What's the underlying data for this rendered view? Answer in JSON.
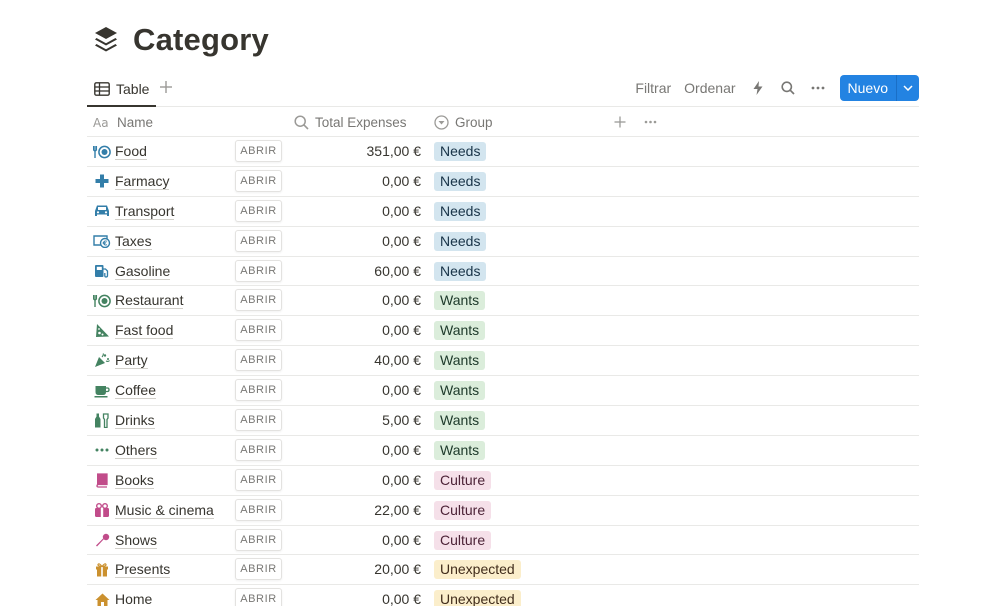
{
  "page": {
    "title": "Category",
    "icon": "layers-icon"
  },
  "views": {
    "active_tab": "Table",
    "toolbar": {
      "filter": "Filtrar",
      "sort": "Ordenar",
      "new": "Nuevo"
    }
  },
  "columns": {
    "name": "Name",
    "total": "Total Expenses",
    "group": "Group"
  },
  "open_label": "ABRIR",
  "group_colors": {
    "Needs": {
      "bg": "#d3e5ef",
      "fg": "#183347"
    },
    "Wants": {
      "bg": "#dbeddb",
      "fg": "#1c3829"
    },
    "Culture": {
      "bg": "#f5e0e9",
      "fg": "#4c2337"
    },
    "Unexpected": {
      "bg": "#fbeecb",
      "fg": "#402c1b"
    }
  },
  "rows": [
    {
      "name": "Food",
      "total": "351,00 €",
      "group": "Needs",
      "icon": "fork-plate-icon",
      "icon_color": "#337ea9"
    },
    {
      "name": "Farmacy",
      "total": "0,00 €",
      "group": "Needs",
      "icon": "medical-cross-icon",
      "icon_color": "#337ea9"
    },
    {
      "name": "Transport",
      "total": "0,00 €",
      "group": "Needs",
      "icon": "car-icon",
      "icon_color": "#337ea9"
    },
    {
      "name": "Taxes",
      "total": "0,00 €",
      "group": "Needs",
      "icon": "money-icon",
      "icon_color": "#337ea9"
    },
    {
      "name": "Gasoline",
      "total": "60,00 €",
      "group": "Needs",
      "icon": "gas-pump-icon",
      "icon_color": "#337ea9"
    },
    {
      "name": "Restaurant",
      "total": "0,00 €",
      "group": "Wants",
      "icon": "fork-plate-icon",
      "icon_color": "#448361"
    },
    {
      "name": "Fast food",
      "total": "0,00 €",
      "group": "Wants",
      "icon": "pizza-icon",
      "icon_color": "#448361"
    },
    {
      "name": "Party",
      "total": "40,00 €",
      "group": "Wants",
      "icon": "party-popper-icon",
      "icon_color": "#448361"
    },
    {
      "name": "Coffee",
      "total": "0,00 €",
      "group": "Wants",
      "icon": "coffee-cup-icon",
      "icon_color": "#448361"
    },
    {
      "name": "Drinks",
      "total": "5,00 €",
      "group": "Wants",
      "icon": "bottles-icon",
      "icon_color": "#448361"
    },
    {
      "name": "Others",
      "total": "0,00 €",
      "group": "Wants",
      "icon": "ellipsis-icon",
      "icon_color": "#448361"
    },
    {
      "name": "Books",
      "total": "0,00 €",
      "group": "Culture",
      "icon": "book-icon",
      "icon_color": "#c14c8a"
    },
    {
      "name": "Music & cinema",
      "total": "22,00 €",
      "group": "Culture",
      "icon": "ticket-icon",
      "icon_color": "#c14c8a"
    },
    {
      "name": "Shows",
      "total": "0,00 €",
      "group": "Culture",
      "icon": "microphone-icon",
      "icon_color": "#c14c8a"
    },
    {
      "name": "Presents",
      "total": "20,00 €",
      "group": "Unexpected",
      "icon": "gift-icon",
      "icon_color": "#cb912f"
    },
    {
      "name": "Home",
      "total": "0,00 €",
      "group": "Unexpected",
      "icon": "house-icon",
      "icon_color": "#cb912f"
    }
  ]
}
